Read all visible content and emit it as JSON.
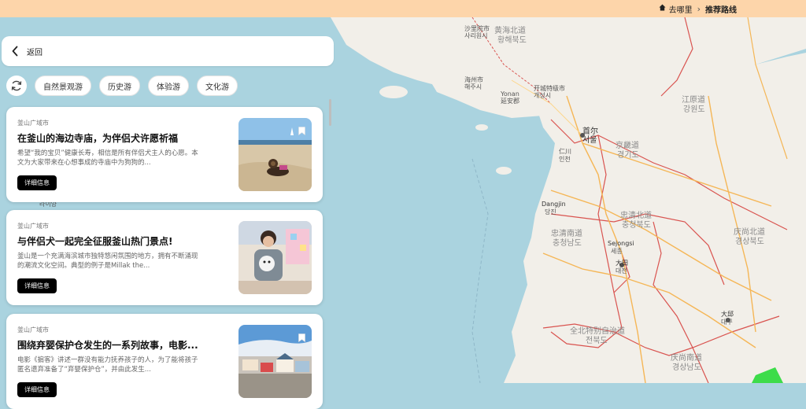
{
  "breadcrumb": {
    "home_label": "去哪里",
    "current_label": "推荐路线"
  },
  "panel": {
    "back_label": "返回",
    "tags": [
      "自然景观游",
      "历史游",
      "体验游",
      "文化游"
    ]
  },
  "cards": [
    {
      "city": "釜山广域市",
      "title": "在釜山的海边寺庙，为伴侣犬许愿祈福",
      "desc": "希望“我的宝贝”健康长寿，相信是所有伴侣犬主人的心愿。本文为大家带来在心想事成的寺庙中为狗狗的...",
      "button": "详细信息"
    },
    {
      "city": "釜山广域市",
      "title": "与伴侣犬一起完全征服釜山热门景点!",
      "desc": "釜山是一个充满海滨城市独特悠闲氛围的地方，拥有不断涌现的潮流文化空间。典型的例子是Millak the...",
      "button": "详细信息"
    },
    {
      "city": "釜山广域市",
      "title": "围绕弃婴保护仓发生的一系列故事，电影...",
      "desc": "电影《掮客》讲述一群没有能力抚养孩子的人，为了能将孩子匿名遗弃准备了“弃婴保护仓”，并由此发生...",
      "button": "详细信息"
    }
  ],
  "map": {
    "labels": {
      "hwanghae_north": "황해북도",
      "hwanghae_north_zh": "黄海北道",
      "sariwon": "사리원시",
      "sariwon_zh": "沙里院市",
      "haeju": "해주시",
      "haeju_zh": "海州市",
      "yonan": "Yonan",
      "yonan_zh": "延安郡",
      "kaesong_zh": "开城特级市",
      "kaesong": "개성시",
      "seoul_zh": "首尔",
      "seoul": "서울",
      "incheon_zh": "仁川",
      "incheon": "인천",
      "gyeonggi_zh": "京畿道",
      "gyeonggi": "경기도",
      "gangwon_zh": "江原道",
      "gangwon": "강원도",
      "chungbuk_zh": "忠清北道",
      "chungbuk": "충청북도",
      "chungnam_zh": "忠清南道",
      "chungnam": "충청남도",
      "sejong": "Sejongsi",
      "sejong_ko": "세종",
      "daejeon_zh": "大田",
      "daejeon": "대전",
      "gyeongbuk_zh": "庆尚北道",
      "gyeongbuk": "경상북도",
      "jeonbuk_zh": "全北特别自治道",
      "jeonbuk": "전북도",
      "gyeongnam_zh": "庆尚南道",
      "gyeongnam": "경상남도",
      "daegu_zh": "大邱",
      "daegu": "대구",
      "dangjin": "Dangjin",
      "dangjin_ko": "당진",
      "laiyang": "라이양"
    }
  }
}
